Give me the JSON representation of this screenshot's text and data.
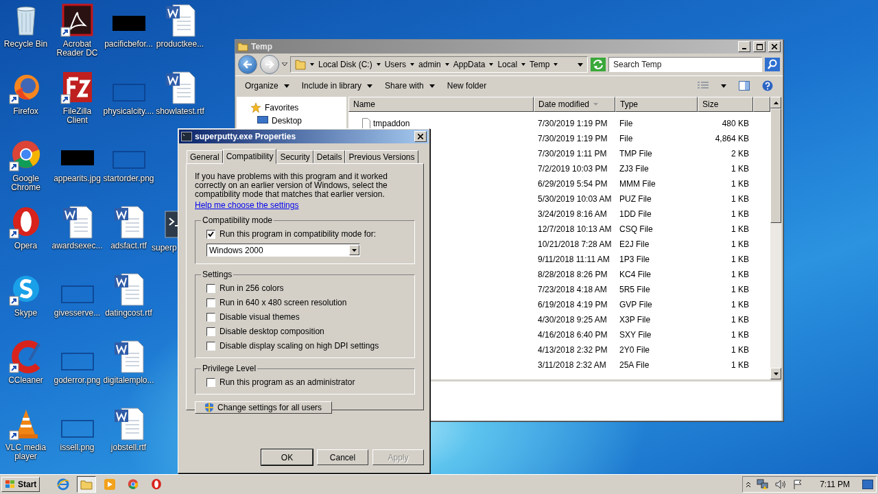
{
  "desktop": {
    "icons": [
      {
        "label": "Recycle Bin",
        "kind": "recycle",
        "shortcut": false
      },
      {
        "label": "Firefox",
        "kind": "firefox",
        "shortcut": true
      },
      {
        "label": "Google Chrome",
        "kind": "chrome",
        "shortcut": true
      },
      {
        "label": "Opera",
        "kind": "opera",
        "shortcut": true
      },
      {
        "label": "Skype",
        "kind": "skype",
        "shortcut": true
      },
      {
        "label": "CCleaner",
        "kind": "ccleaner",
        "shortcut": true
      },
      {
        "label": "VLC media player",
        "kind": "vlc",
        "shortcut": true
      },
      {
        "label": "Acrobat Reader DC",
        "kind": "acrobat",
        "shortcut": true
      },
      {
        "label": "FileZilla Client",
        "kind": "filezilla",
        "shortcut": true
      },
      {
        "label": "appearits.jpg",
        "kind": "dark-thumb",
        "shortcut": false
      },
      {
        "label": "awardsexec...",
        "kind": "document",
        "shortcut": false
      },
      {
        "label": "givesserve...",
        "kind": "blank-thumb",
        "shortcut": false
      },
      {
        "label": "goderror.png",
        "kind": "blank-thumb",
        "shortcut": false
      },
      {
        "label": "issell.png",
        "kind": "blank-thumb",
        "shortcut": false
      },
      {
        "label": "pacificbefor...",
        "kind": "dark-thumb",
        "shortcut": false
      },
      {
        "label": "physicalcity....",
        "kind": "blank-thumb",
        "shortcut": false
      },
      {
        "label": "startorder.png",
        "kind": "blank-thumb",
        "shortcut": false
      },
      {
        "label": "adsfact.rtf",
        "kind": "document",
        "shortcut": false
      },
      {
        "label": "datingcost.rtf",
        "kind": "document",
        "shortcut": false
      },
      {
        "label": "digitalemplo...",
        "kind": "document",
        "shortcut": false
      },
      {
        "label": "jobstell.rtf",
        "kind": "document",
        "shortcut": false
      },
      {
        "label": "productkee...",
        "kind": "document",
        "shortcut": false
      },
      {
        "label": "showlatest.rtf",
        "kind": "document",
        "shortcut": false
      },
      {
        "label": "superp",
        "kind": "terminal",
        "shortcut": false,
        "gap_before": true,
        "cut": true
      }
    ]
  },
  "explorer": {
    "title": "Temp",
    "breadcrumbs": [
      "Local Disk (C:)",
      "Users",
      "admin",
      "AppData",
      "Local",
      "Temp"
    ],
    "search": {
      "placeholder": "Search Temp"
    },
    "toolbar": [
      {
        "label": "Organize",
        "menu": true
      },
      {
        "label": "Include in library",
        "menu": true
      },
      {
        "label": "Share with",
        "menu": true
      },
      {
        "label": "New folder",
        "menu": false
      }
    ],
    "nav": [
      {
        "label": "Favorites",
        "kind": "favorites"
      },
      {
        "label": "Desktop",
        "kind": "desktop"
      }
    ],
    "columns": [
      {
        "label": "Name",
        "sorted": false
      },
      {
        "label": "Date modified",
        "sorted": true
      },
      {
        "label": "Type",
        "sorted": false
      },
      {
        "label": "Size",
        "sorted": false
      }
    ],
    "rows": [
      {
        "name": "tmpaddon",
        "date": "7/30/2019 1:19 PM",
        "type": "File",
        "size": "480 KB"
      },
      {
        "date": "7/30/2019 1:19 PM",
        "type": "File",
        "size": "4,864 KB"
      },
      {
        "date": "7/30/2019 1:11 PM",
        "type": "TMP File",
        "size": "2 KB"
      },
      {
        "date": "7/2/2019 10:03 PM",
        "type": "ZJ3 File",
        "size": "1 KB"
      },
      {
        "date": "6/29/2019 5:54 PM",
        "type": "MMM File",
        "size": "1 KB"
      },
      {
        "date": "5/30/2019 10:03 AM",
        "type": "PUZ File",
        "size": "1 KB"
      },
      {
        "date": "3/24/2019 8:16 AM",
        "type": "1DD File",
        "size": "1 KB"
      },
      {
        "date": "12/7/2018 10:13 AM",
        "type": "CSQ File",
        "size": "1 KB"
      },
      {
        "date": "10/21/2018 7:28 AM",
        "type": "E2J File",
        "size": "1 KB"
      },
      {
        "date": "9/11/2018 11:11 AM",
        "type": "1P3 File",
        "size": "1 KB"
      },
      {
        "date": "8/28/2018 8:26 PM",
        "type": "KC4 File",
        "size": "1 KB"
      },
      {
        "date": "7/23/2018 4:18 AM",
        "type": "5R5 File",
        "size": "1 KB"
      },
      {
        "date": "6/19/2018 4:19 PM",
        "type": "GVP File",
        "size": "1 KB"
      },
      {
        "date": "4/30/2018 9:25 AM",
        "type": "X3P File",
        "size": "1 KB"
      },
      {
        "date": "4/16/2018 6:40 PM",
        "type": "SXY File",
        "size": "1 KB"
      },
      {
        "date": "4/13/2018 2:32 PM",
        "type": "2Y0 File",
        "size": "1 KB"
      },
      {
        "date": "3/11/2018 2:32 AM",
        "type": "25A File",
        "size": "1 KB"
      }
    ]
  },
  "dialog": {
    "title": "superputty.exe Properties",
    "tabs": [
      {
        "label": "General",
        "selected": false
      },
      {
        "label": "Compatibility",
        "selected": true
      },
      {
        "label": "Security",
        "selected": false
      },
      {
        "label": "Details",
        "selected": false
      },
      {
        "label": "Previous Versions",
        "selected": false
      }
    ],
    "intro": "If you have problems with this program and it worked correctly on an earlier version of Windows, select the compatibility mode that matches that earlier version.",
    "link": "Help me choose the settings",
    "groups": [
      {
        "title": "Compatibility mode",
        "options": [
          {
            "kind": "checkbox",
            "label": "Run this program in compatibility mode for:",
            "checked": true
          },
          {
            "kind": "select",
            "value": "Windows 2000"
          }
        ]
      },
      {
        "title": "Settings",
        "options": [
          {
            "kind": "checkbox",
            "label": "Run in 256 colors",
            "checked": false
          },
          {
            "kind": "checkbox",
            "label": "Run in 640 x 480 screen resolution",
            "checked": false
          },
          {
            "kind": "checkbox",
            "label": "Disable visual themes",
            "checked": false
          },
          {
            "kind": "checkbox",
            "label": "Disable desktop composition",
            "checked": false
          },
          {
            "kind": "checkbox",
            "label": "Disable display scaling on high DPI settings",
            "checked": false
          }
        ]
      },
      {
        "title": "Privilege Level",
        "options": [
          {
            "kind": "checkbox",
            "label": "Run this program as an administrator",
            "checked": false
          }
        ]
      }
    ],
    "all_users_button": "Change settings for all users",
    "buttons": [
      {
        "label": "OK",
        "default": true,
        "disabled": false
      },
      {
        "label": "Cancel",
        "default": false,
        "disabled": false
      },
      {
        "label": "Apply",
        "default": false,
        "disabled": true
      }
    ]
  },
  "taskbar": {
    "start": "Start",
    "apps": [
      {
        "kind": "ie",
        "active": false
      },
      {
        "kind": "explorer",
        "active": true
      },
      {
        "kind": "media",
        "active": false
      },
      {
        "kind": "chrome",
        "active": false
      },
      {
        "kind": "opera",
        "active": false
      }
    ],
    "clock": "7:11 PM"
  }
}
